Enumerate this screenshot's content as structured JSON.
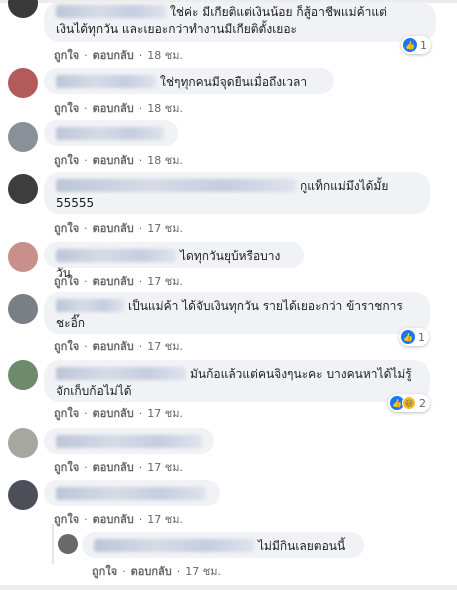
{
  "actions": {
    "like": "ถูกใจ",
    "reply": "ตอบกลับ",
    "dot": "·"
  },
  "comments": [
    {
      "text": "ใช่ค่ะ มีเกียติแต่เงินน้อย ก็สู้อาชีพแม่ค้าแต่เงินได้ทุกวัน และเยอะกว่าทำงานมีเกียติตั้งเยอะ",
      "line1": "ใช่ค่ะ มีเกียติแต่เงินน้อย ก็สู้อาชีพแม่ค้าแต่",
      "line2": "เงินได้ทุกวัน และเยอะกว่าทำงานมีเกียติตั้งเยอะ",
      "time": "18 ชม.",
      "reactions": "1"
    },
    {
      "text": "ใช่ๆทุกคนมีจุดยืนเมื่อถึงเวลา",
      "time": "18 ชม."
    },
    {
      "text": "",
      "time": "18 ชม."
    },
    {
      "line1": "กูแท็กแม่มึงได้มั้ย",
      "line2": "55555",
      "time": "17 ชม."
    },
    {
      "text": "ไดทุกวันยุบ้หรือบางวัน",
      "time": "17 ชม."
    },
    {
      "line1": "เป็นแม่ค้า ได้จับเงินทุกวัน รายได้เยอะกว่า ข้าราชการ",
      "line2": "ชะอิ๊ก",
      "time": "17 ชม.",
      "reactions": "1"
    },
    {
      "line1": "มันก้อแล้วแต่คนจิงๆนะคะ บางคนหาได้ไม่รู้",
      "line2": "จักเก็บก้อไม่ได้",
      "time": "17 ชม.",
      "reactions": "2"
    },
    {
      "text": "",
      "time": "17 ชม."
    },
    {
      "text": "",
      "time": "17 ชม."
    }
  ],
  "reply": {
    "text": "ไม่มีกินเลยตอนนี้",
    "time": "17 ชม."
  }
}
